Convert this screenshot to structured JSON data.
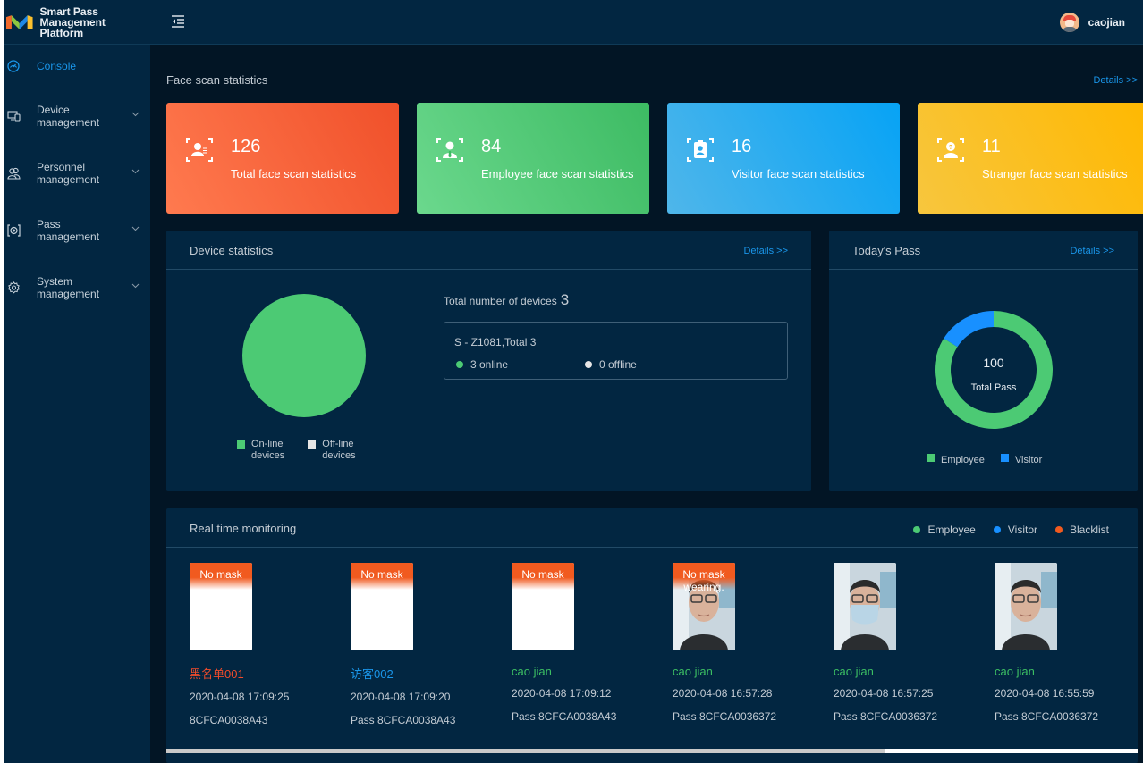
{
  "app": {
    "title_line1": "Smart Pass",
    "title_line2": "Management Platform"
  },
  "user": {
    "name": "caojian"
  },
  "sidebar": {
    "items": [
      {
        "label": "Console",
        "active": true,
        "icon": "dashboard-gauge-icon"
      },
      {
        "label1": "Device",
        "label2": "management",
        "icon": "devices-icon"
      },
      {
        "label1": "Personnel",
        "label2": "management",
        "icon": "people-icon"
      },
      {
        "label1": "Pass",
        "label2": "management",
        "icon": "face-scan-icon"
      },
      {
        "label1": "System",
        "label2": "management",
        "icon": "gear-icon"
      }
    ]
  },
  "face_scan": {
    "title": "Face scan statistics",
    "details": "Details >>",
    "cards": [
      {
        "value": "126",
        "label": "Total face scan statistics",
        "icon": "face-list-icon",
        "from": "#ff7a4f",
        "to": "#f0502a"
      },
      {
        "value": "84",
        "label": "Employee face scan statistics",
        "icon": "employee-icon",
        "from": "#6bd88d",
        "to": "#3dbb63"
      },
      {
        "value": "16",
        "label": "Visitor face scan statistics",
        "icon": "visitor-badge-icon",
        "from": "#4fb6ea",
        "to": "#07a3f5"
      },
      {
        "value": "11",
        "label": "Stranger face scan statistics",
        "icon": "stranger-icon",
        "from": "#f7c63e",
        "to": "#ffb800"
      }
    ]
  },
  "device_stats": {
    "title": "Device statistics",
    "details": "Details >>",
    "total_label": "Total number of devices",
    "total_value": "3",
    "device_name": "S - Z1081,Total 3",
    "online": "3 online",
    "offline": "0 offline",
    "legend": [
      {
        "line1": "On-line",
        "line2": "devices",
        "color": "#4cca74"
      },
      {
        "line1": "Off-line",
        "line2": "devices",
        "color": "#e6e6e6"
      }
    ]
  },
  "todays_pass": {
    "title": "Today's Pass",
    "details": "Details >>",
    "center_value": "100",
    "center_label": "Total Pass",
    "legend": [
      {
        "label": "Employee",
        "color": "#4cca74"
      },
      {
        "label": "Visitor",
        "color": "#1890ff"
      }
    ]
  },
  "chart_data": [
    {
      "type": "pie",
      "title": "Device statistics",
      "categories": [
        "On-line devices",
        "Off-line devices"
      ],
      "values": [
        3,
        0
      ],
      "colors": [
        "#4cca74",
        "#e6e6e6"
      ],
      "legend": "bottom"
    },
    {
      "type": "pie",
      "variant": "donut",
      "title": "Today's Pass",
      "categories": [
        "Employee",
        "Visitor"
      ],
      "values": [
        84,
        16
      ],
      "colors": [
        "#4cca74",
        "#1890ff"
      ],
      "center_text": [
        "100",
        "Total Pass"
      ],
      "legend": "bottom"
    }
  ],
  "monitoring": {
    "title": "Real time monitoring",
    "legend": [
      {
        "label": "Employee",
        "color": "#4cca74"
      },
      {
        "label": "Visitor",
        "color": "#1890ff"
      },
      {
        "label": "Blacklist",
        "color": "#f15a1f"
      }
    ],
    "records": [
      {
        "name": "黑名单001",
        "type": "blacklist",
        "color": "#f04b2b",
        "time": "2020-04-08 17:09:25",
        "pass": "8CFCA0038A43",
        "banner": "No mask",
        "photo": "blank"
      },
      {
        "name": "访客002",
        "type": "visitor",
        "color": "#1a96ea",
        "time": "2020-04-08 17:09:20",
        "pass": "Pass 8CFCA0038A43",
        "banner": "No mask",
        "photo": "blank"
      },
      {
        "name": "cao jian",
        "type": "employee",
        "color": "#3cbf63",
        "time": "2020-04-08 17:09:12",
        "pass": "Pass 8CFCA0038A43",
        "banner": "No mask",
        "photo": "blank"
      },
      {
        "name": "cao jian",
        "type": "employee",
        "color": "#3cbf63",
        "time": "2020-04-08 16:57:28",
        "pass": "Pass 8CFCA0036372",
        "banner": "No mask wearing.",
        "photo": "face"
      },
      {
        "name": "cao jian",
        "type": "employee",
        "color": "#3cbf63",
        "time": "2020-04-08 16:57:25",
        "pass": "Pass 8CFCA0036372",
        "banner": "",
        "photo": "face-masked"
      },
      {
        "name": "cao jian",
        "type": "employee",
        "color": "#3cbf63",
        "time": "2020-04-08 16:55:59",
        "pass": "Pass 8CFCA0036372",
        "banner": "",
        "photo": "face"
      }
    ],
    "scroll_fraction": 0.74
  }
}
